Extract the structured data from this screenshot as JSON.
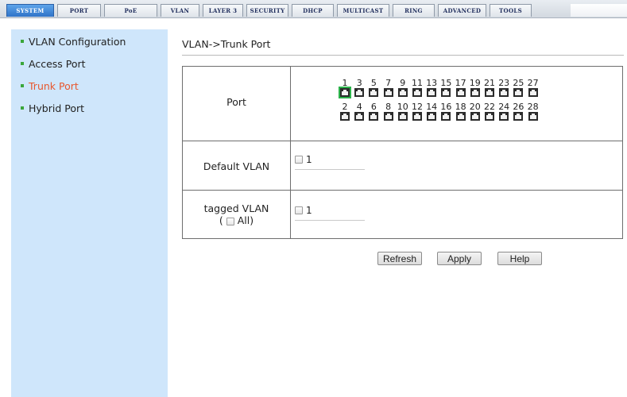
{
  "tabs": [
    {
      "label": "SYSTEM",
      "active": true
    },
    {
      "label": "PORT",
      "active": false
    },
    {
      "label": "PoE",
      "active": false
    },
    {
      "label": "VLAN",
      "active": false
    },
    {
      "label": "LAYER 3",
      "active": false
    },
    {
      "label": "SECURITY",
      "active": false
    },
    {
      "label": "DHCP",
      "active": false
    },
    {
      "label": "MULTICAST",
      "active": false
    },
    {
      "label": "RING",
      "active": false
    },
    {
      "label": "ADVANCED",
      "active": false
    },
    {
      "label": "TOOLS",
      "active": false
    }
  ],
  "sidebar": {
    "items": [
      {
        "label": "VLAN Configuration",
        "active": false
      },
      {
        "label": "Access Port",
        "active": false
      },
      {
        "label": "Trunk Port",
        "active": true
      },
      {
        "label": "Hybrid Port",
        "active": false
      }
    ]
  },
  "main": {
    "breadcrumb": "VLAN->Trunk Port",
    "port_label": "Port",
    "ports_top": [
      "1",
      "3",
      "5",
      "7",
      "9",
      "11",
      "13",
      "15",
      "17",
      "19",
      "21",
      "23",
      "25",
      "27"
    ],
    "ports_bottom": [
      "2",
      "4",
      "6",
      "8",
      "10",
      "12",
      "14",
      "16",
      "18",
      "20",
      "22",
      "24",
      "26",
      "28"
    ],
    "selected_port": "1",
    "default_vlan_label": "Default VLAN",
    "default_vlan_value": "1",
    "tagged_vlan_label": "tagged VLAN",
    "tagged_all_open": "(",
    "tagged_all_label": "All)",
    "tagged_vlan_value": "1"
  },
  "buttons": {
    "refresh": "Refresh",
    "apply": "Apply",
    "help": "Help"
  },
  "colors": {
    "active_tab": "#2f73c8",
    "sidebar_bg": "#cfe6fb",
    "active_menu": "#e8572d",
    "bullet": "#3aa63a",
    "selected_port": "#2bb24a"
  }
}
